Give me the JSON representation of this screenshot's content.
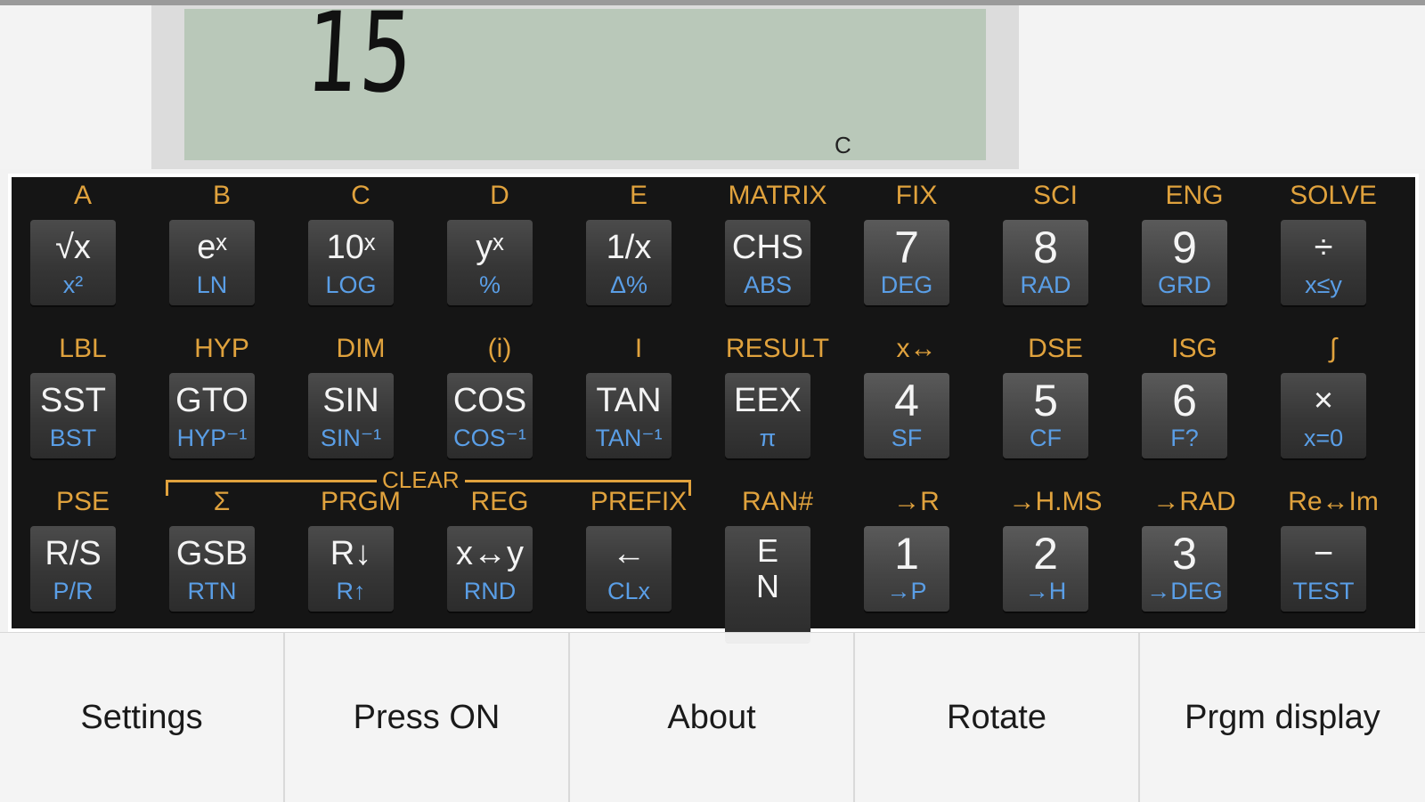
{
  "display": {
    "value": "15",
    "annunciator": "C"
  },
  "keys": {
    "r1c1": {
      "gold": "A",
      "main": "√x",
      "blue": "x²"
    },
    "r1c2": {
      "gold": "B",
      "main": "eˣ",
      "blue": "LN"
    },
    "r1c3": {
      "gold": "C",
      "main": "10ˣ",
      "blue": "LOG"
    },
    "r1c4": {
      "gold": "D",
      "main": "yˣ",
      "blue": "%"
    },
    "r1c5": {
      "gold": "E",
      "main": "1/x",
      "blue": "Δ%"
    },
    "r1c6": {
      "gold": "MATRIX",
      "main": "CHS",
      "blue": "ABS"
    },
    "r1c7": {
      "gold": "FIX",
      "main": "7",
      "blue": "DEG"
    },
    "r1c8": {
      "gold": "SCI",
      "main": "8",
      "blue": "RAD"
    },
    "r1c9": {
      "gold": "ENG",
      "main": "9",
      "blue": "GRD"
    },
    "r1c10": {
      "gold": "SOLVE",
      "main": "÷",
      "blue": "x≤y"
    },
    "r2c1": {
      "gold": "LBL",
      "main": "SST",
      "blue": "BST"
    },
    "r2c2": {
      "gold": "HYP",
      "main": "GTO",
      "blue": "HYP⁻¹"
    },
    "r2c3": {
      "gold": "DIM",
      "main": "SIN",
      "blue": "SIN⁻¹"
    },
    "r2c4": {
      "gold": "(i)",
      "main": "COS",
      "blue": "COS⁻¹"
    },
    "r2c5": {
      "gold": "I",
      "main": "TAN",
      "blue": "TAN⁻¹"
    },
    "r2c6": {
      "gold": "RESULT",
      "main": "EEX",
      "blue": "π"
    },
    "r2c7": {
      "gold": "x↔",
      "main": "4",
      "blue": "SF"
    },
    "r2c8": {
      "gold": "DSE",
      "main": "5",
      "blue": "CF"
    },
    "r2c9": {
      "gold": "ISG",
      "main": "6",
      "blue": "F?"
    },
    "r2c10": {
      "gold": "∫",
      "main": "×",
      "blue": "x=0"
    },
    "r3c1": {
      "gold": "PSE",
      "main": "R/S",
      "blue": "P/R"
    },
    "r3c2": {
      "gold": "Σ",
      "main": "GSB",
      "blue": "RTN"
    },
    "r3c3": {
      "gold": "PRGM",
      "main": "R↓",
      "blue": "R↑"
    },
    "r3c4": {
      "gold": "REG",
      "main": "x↔y",
      "blue": "RND"
    },
    "r3c5": {
      "gold": "PREFIX",
      "main": "←",
      "blue": "CLx"
    },
    "r3c6": {
      "gold": "RAN#",
      "main": "E\nN",
      "blue": ""
    },
    "r3c7": {
      "gold": "→R",
      "main": "1",
      "blue": "→P"
    },
    "r3c8": {
      "gold": "→H.MS",
      "main": "2",
      "blue": "→H"
    },
    "r3c9": {
      "gold": "→RAD",
      "main": "3",
      "blue": "→DEG"
    },
    "r3c10": {
      "gold": "Re↔Im",
      "main": "−",
      "blue": "TEST"
    },
    "clear_label": "CLEAR"
  },
  "menu": {
    "settings": "Settings",
    "press_on": "Press ON",
    "about": "About",
    "rotate": "Rotate",
    "prgm_display": "Prgm display"
  },
  "colors": {
    "gold": "#e0a23d",
    "blue": "#5a9ee6",
    "lcd": "#b9c8b9"
  }
}
